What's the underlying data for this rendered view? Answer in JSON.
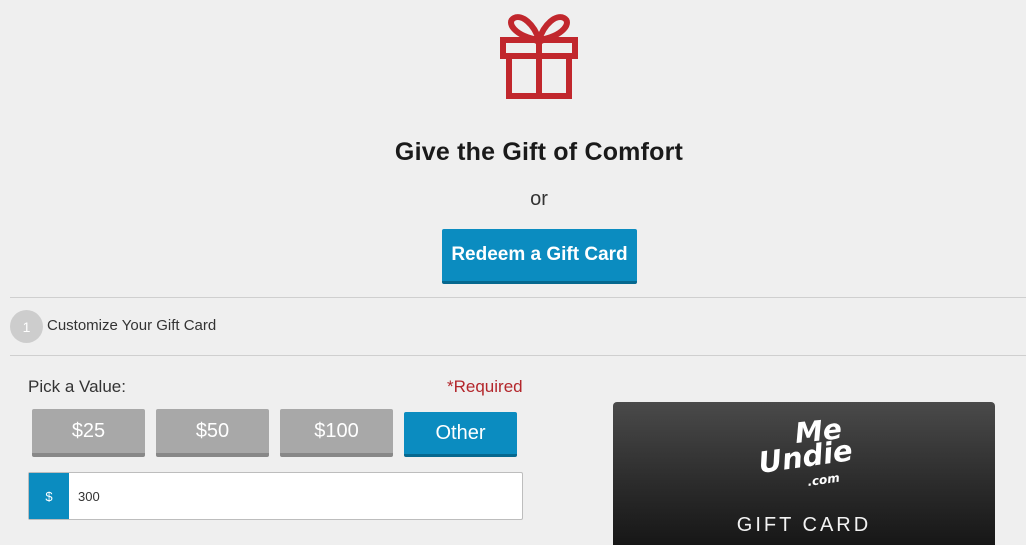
{
  "hero": {
    "icon": "gift-icon",
    "title": "Give the Gift of Comfort",
    "or_text": "or",
    "redeem_button": "Redeem a Gift Card"
  },
  "step": {
    "number": "1",
    "label": "Customize Your Gift Card"
  },
  "value_picker": {
    "label": "Pick a Value:",
    "required_text": "*Required",
    "options": [
      "$25",
      "$50",
      "$100",
      "Other"
    ],
    "selected": "Other",
    "currency_symbol": "$",
    "custom_amount": "300"
  },
  "card_preview": {
    "logo_line1": "Me",
    "logo_line2": "Undies",
    "logo_line3": ".com",
    "label": "GIFT CARD"
  },
  "colors": {
    "accent": "#0b8cc0",
    "gift_icon": "#c1272d",
    "required": "#b3262b",
    "inactive_button": "#a8a8a8",
    "background": "#efefef"
  }
}
